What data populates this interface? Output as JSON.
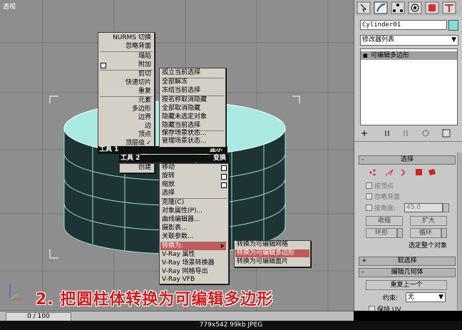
{
  "viewport": {
    "label": "透视"
  },
  "quad_left": {
    "items": [
      "NURMS 切换",
      "忽略背面",
      "塌陷",
      "附加",
      "剪切",
      "快速切片",
      "重复",
      "元素",
      "多边形",
      "边界",
      "边",
      "顶点",
      "顶层级"
    ],
    "check": "✓",
    "tools1": "工具 1",
    "tools2": "工具 2",
    "create": "创建"
  },
  "quad_right": {
    "items": [
      "孤立当前选择",
      "全部解冻",
      "冻结当前选择",
      "按名称取消隐藏",
      "全部取消隐藏",
      "隐藏未选定对象",
      "隐藏当前选择",
      "保存场景状态...",
      "管理场景状态..."
    ],
    "display": "显示",
    "transform": "变换"
  },
  "quad_lower": {
    "items": [
      "移动",
      "旋转",
      "缩放",
      "选择",
      "克隆(C)",
      "对象属性(P)...",
      "曲线编辑器...",
      "摄影表...",
      "关联参数...",
      "转换为:",
      "V-Ray 属性",
      "V-Ray 场景转换器",
      "V-Ray 网格导出",
      "V-Ray VFB"
    ]
  },
  "convert_submenu": {
    "items": [
      "转换为可编辑网格",
      "转换为可编辑多边形",
      "转换为可编辑面片"
    ]
  },
  "caption": "2. 把圆柱体转换为可编辑多边形",
  "panel": {
    "object_name": "Cylinder01",
    "object_color": "#80e0d8",
    "modifier_list": "修改器列表",
    "stack_item": "可编辑多边形",
    "rollout_selection": "选择",
    "by_vertex": "按顶点",
    "ignore_backface": "忽略背面",
    "by_angle": "按角度:",
    "angle_value": "45.0",
    "shrink": "收缩",
    "grow": "扩大",
    "ring": "环形",
    "loop": "循环",
    "selected_info": "选定整个对象",
    "rollout_soft": "软选择",
    "rollout_edit_geo": "编辑几何体",
    "repeat_last": "重复上一个",
    "constraint_label": "约束:",
    "constraint_value": "无",
    "preserve_uv": "保持 UV"
  },
  "timeline": {
    "frame": "0 / 100"
  },
  "status": {
    "text": "779x542  99kb  JPEG"
  }
}
